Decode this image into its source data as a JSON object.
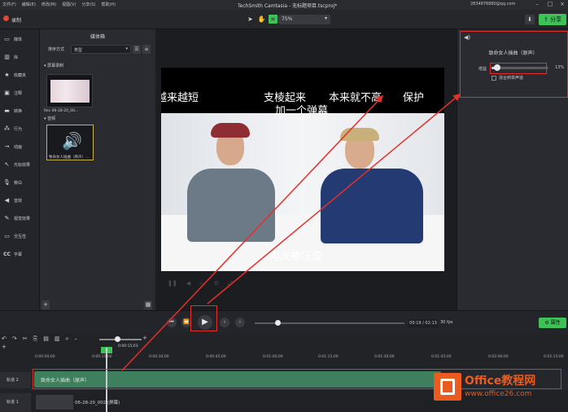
{
  "titlebar": {
    "menu": [
      "文件(F)",
      "编辑(E)",
      "修改(M)",
      "视图(V)",
      "分享(S)",
      "帮助(H)"
    ],
    "title": "TechSmith Camtasia - 无标题项目.tscproj*",
    "account": "2834876880@qq.com"
  },
  "toolbar": {
    "record_label": "录制",
    "zoom_value": "75%",
    "share_label": "分享"
  },
  "leftnav": {
    "items": [
      "媒体",
      "库",
      "收藏夹",
      "注释",
      "转换",
      "行为",
      "动画",
      "光标效果",
      "旁白",
      "音效",
      "视觉效果",
      "交互性",
      "字幕"
    ]
  },
  "mediabin": {
    "title": "媒体箱",
    "sort_label": "排序方式",
    "sort_value": "类型",
    "section_screen": "屏幕录制",
    "screen_clip_caption": "Rec 06-28-20_00...",
    "section_audio": "音频",
    "audio_clip_caption": "致命女人插曲（原声）..."
  },
  "canvas": {
    "subtitle_left": "越来越短",
    "subtitle_mid": "支棱起来",
    "subtitle_right": "本来就不高",
    "subtitle_protect": "保护",
    "subtitle_second": "加一个弹幕",
    "subtitle_bottom": "再次被压低"
  },
  "properties": {
    "title": "致命女人插曲（原声）",
    "volume_label": "增益",
    "volume_percent": 13,
    "volume_display": "13%",
    "mix_label": "混合到单声道"
  },
  "playback": {
    "timecode": "00:19 / 02:13",
    "fps": "30 fps",
    "properties_button": "属性"
  },
  "timeline": {
    "playhead_time": "0:00:15;03",
    "ticks": [
      "0:00:00;00",
      "0:00:15;00",
      "0:00:30;00",
      "0:00:45;00",
      "0:01:00;00",
      "0:01:15;00",
      "0:01:30;00",
      "0:01:45;00",
      "0:02:00;00",
      "0:02:15;00"
    ],
    "track2_label": "轨道 2",
    "audio_clip_label": "致命女人插曲（原声）",
    "track1_label": "轨道 1",
    "screen_clip_label": "06-28-20_002 (屏幕)"
  },
  "watermark": {
    "name": "Office教程网",
    "url": "www.office26.com"
  },
  "colors": {
    "accent": "#3ec157",
    "annotation": "#e5302a",
    "audio_clip": "#3e7f5d",
    "record": "#e2453c"
  }
}
